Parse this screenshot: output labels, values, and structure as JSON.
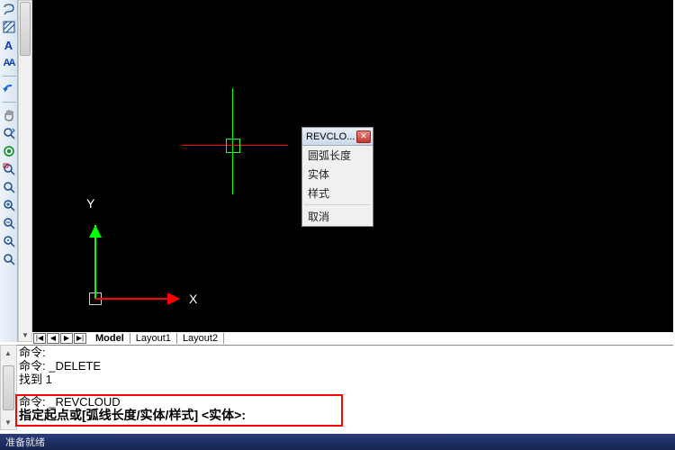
{
  "toolbar_icons": [
    "lasso",
    "hatch",
    "text-A",
    "text-AA",
    "pan",
    "realtime",
    "rotate",
    "zoom-window",
    "zoom-extents",
    "zoom-in",
    "zoom-out",
    "zoom-window2",
    "zoom-all"
  ],
  "ucs": {
    "y_label": "Y",
    "x_label": "X"
  },
  "popup": {
    "title": "REVCLO...",
    "items": [
      "圆弧长度",
      "实体",
      "样式"
    ],
    "cancel": "取消"
  },
  "tabs": {
    "nav": [
      "|◀",
      "◀",
      "▶",
      "▶|"
    ],
    "items": [
      "Model",
      "Layout1",
      "Layout2"
    ]
  },
  "cmd": {
    "l1": "命令:",
    "l2": "命令: _DELETE",
    "l3": "找到 1",
    "l4": "命令: _REVCLOUD",
    "l5": "指定起点或[弧线长度/实体/样式] <实体>:"
  },
  "status": "准备就绪"
}
